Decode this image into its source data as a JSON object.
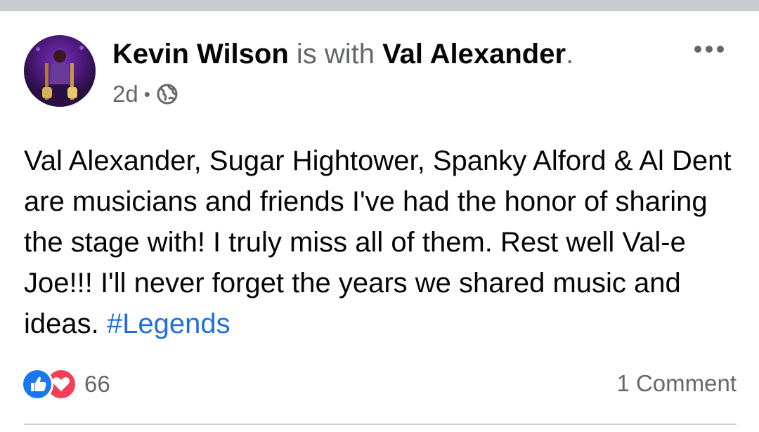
{
  "post": {
    "author": "Kevin Wilson",
    "with_text": "is with",
    "tagged": "Val Alexander",
    "period": ".",
    "time": "2d",
    "separator": "•",
    "privacy_icon": "globe-icon",
    "more_icon": "more-options-icon",
    "text_main": "Val Alexander, Sugar Hightower, Spanky Alford & Al Dent are musicians and friends I've had the honor of sharing the stage with! I truly miss all of them. Rest well Val-e Joe!!! I'll never forget the years we shared music and ideas. ",
    "hashtag": "#Legends"
  },
  "reactions": {
    "icons": [
      "like-icon",
      "love-icon"
    ],
    "count": "66"
  },
  "comments": {
    "label": "1 Comment"
  },
  "colors": {
    "link": "#216fdb",
    "like": "#1877f2",
    "love": "#f33e58",
    "muted": "#65676b",
    "text": "#050505"
  }
}
